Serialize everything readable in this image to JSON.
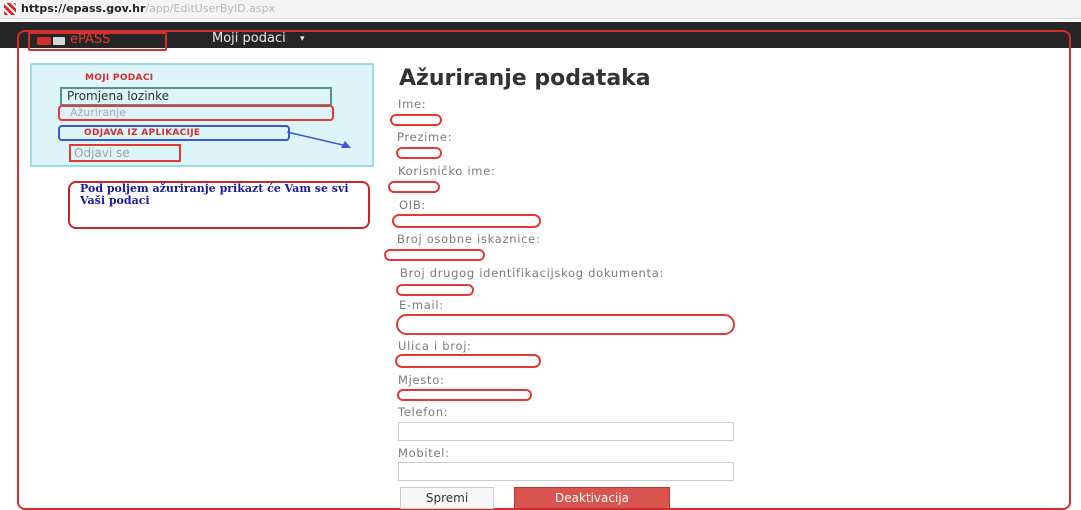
{
  "browser": {
    "url_host": "https://epass.gov.hr",
    "url_path": "/app/EditUserByID.aspx"
  },
  "navbar": {
    "brand": "ePASS",
    "menu_label": "Moji podaci",
    "menu_caret": "▾"
  },
  "sidebar": {
    "section1_heading": "MOJI PODACI",
    "items": [
      {
        "label": "Promjena lozinke"
      },
      {
        "label": "Ažuriranje"
      }
    ],
    "section2_heading": "ODJAVA IZ APLIKACIJE",
    "logout_label": "Odjavi se"
  },
  "annotation": {
    "callout_text": "Pod poljem ažuriranje prikazt će Vam se svi Vaši podaci"
  },
  "form": {
    "title": "Ažuriranje podataka",
    "fields": [
      {
        "label": "Ime:"
      },
      {
        "label": "Prezime:"
      },
      {
        "label": "Korisničko ime:"
      },
      {
        "label": "OIB:"
      },
      {
        "label": "Broj osobne iskaznice:"
      },
      {
        "label": "Broj drugog identifikacijskog dokumenta:"
      },
      {
        "label": "E-mail:"
      },
      {
        "label": "Ulica i broj:"
      },
      {
        "label": "Mjesto:"
      },
      {
        "label": "Telefon:",
        "value": ""
      },
      {
        "label": "Mobitel:",
        "value": ""
      }
    ],
    "save_label": "Spremi",
    "deactivate_label": "Deaktivacija"
  },
  "colors": {
    "accent_red": "#d32f2f",
    "navbar_bg": "#262626",
    "sidebar_bg": "#ddf5f8",
    "annotation_blue": "#3a57d8"
  }
}
